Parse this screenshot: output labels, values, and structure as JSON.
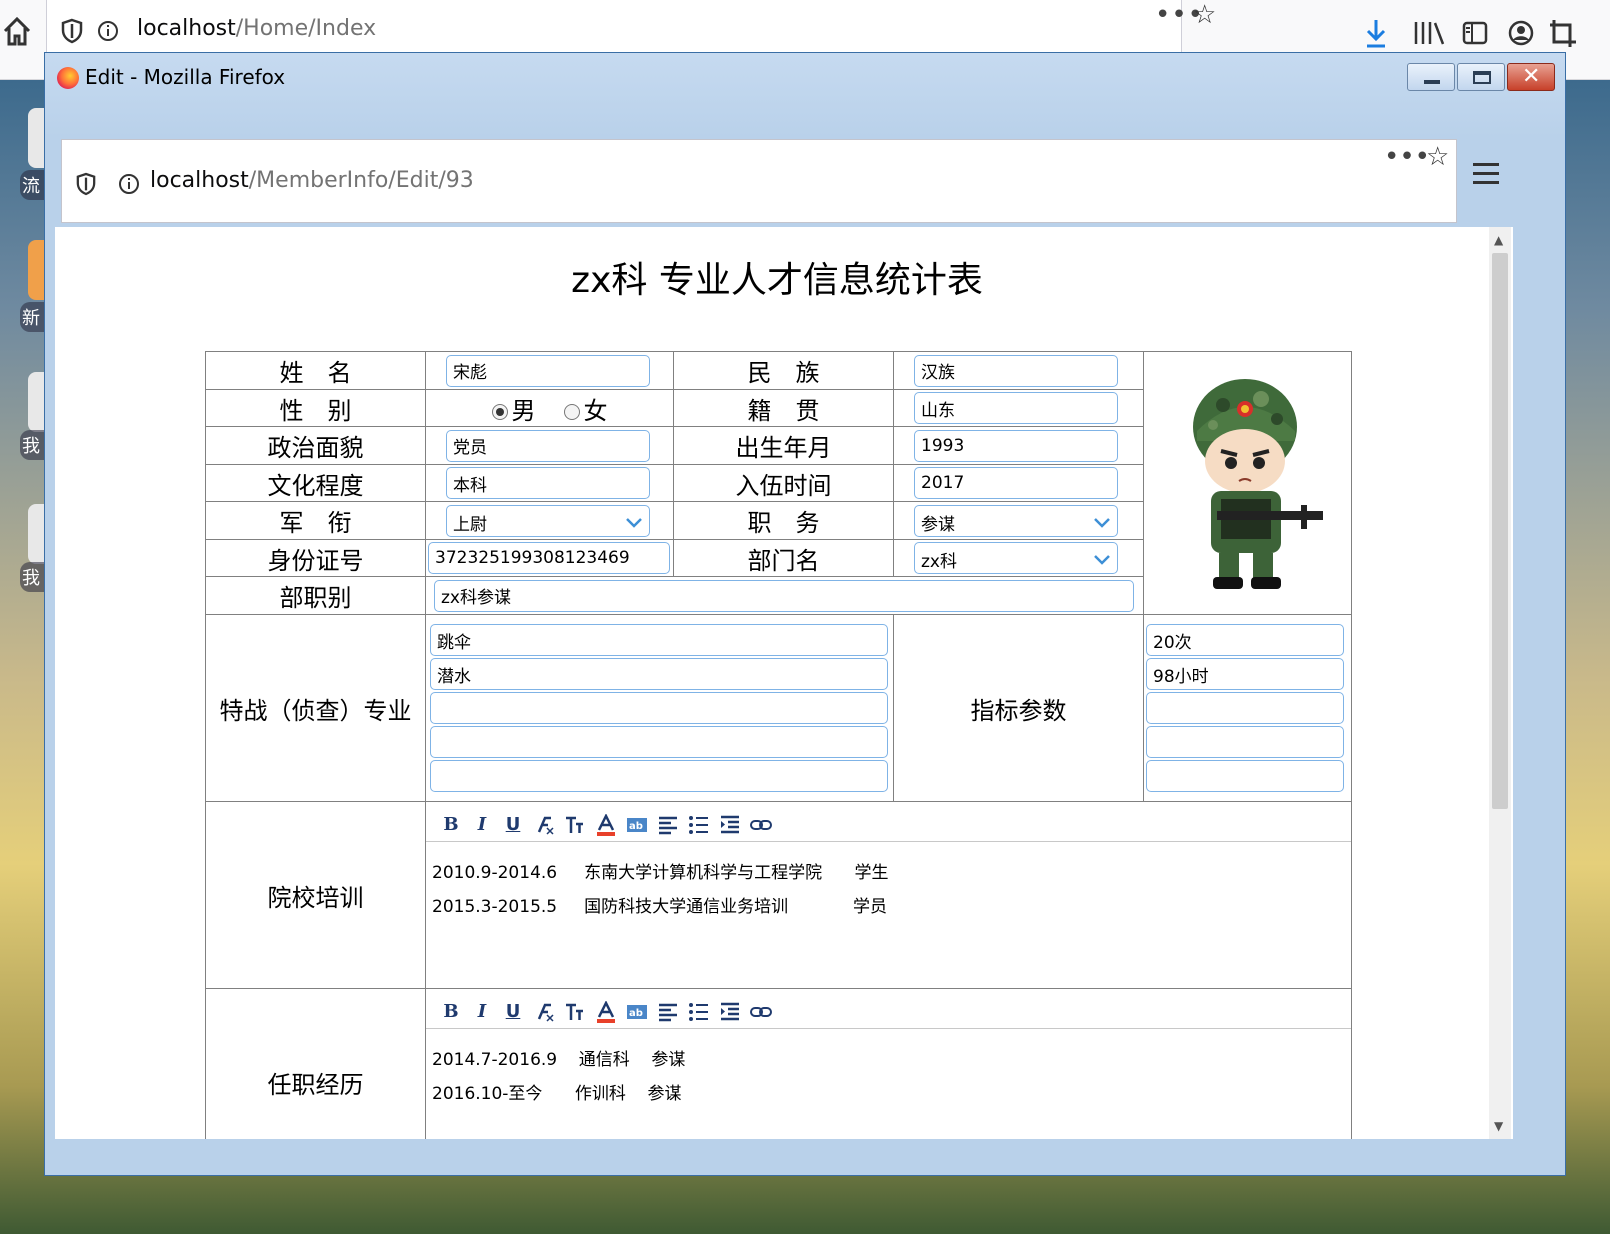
{
  "bg_browser": {
    "url_host": "localhost",
    "url_path": "/Home/Index"
  },
  "desktop": {
    "labels": [
      "流",
      "新",
      "我",
      "我"
    ]
  },
  "window": {
    "title": "Edit - Mozilla Firefox",
    "url_host": "localhost",
    "url_path": "/MemberInfo/Edit/93"
  },
  "page": {
    "title": "zx科 专业人才信息统计表"
  },
  "form": {
    "name_label": "姓　名",
    "name_value": "宋彪",
    "ethnic_label": "民　族",
    "ethnic_value": "汉族",
    "gender_label": "性　别",
    "gender_options": [
      "男",
      "女"
    ],
    "gender_selected": "男",
    "origin_label": "籍　贯",
    "origin_value": "山东",
    "political_label": "政治面貌",
    "political_value": "党员",
    "birth_label": "出生年月",
    "birth_value": "1993",
    "education_label": "文化程度",
    "education_value": "本科",
    "enlist_label": "入伍时间",
    "enlist_value": "2017",
    "rank_label": "军　衔",
    "rank_value": "上尉",
    "position_label": "职　务",
    "position_value": "参谋",
    "id_label": "身份证号",
    "id_value": "372325199308123469",
    "dept_label": "部门名",
    "dept_value": "zx科",
    "level_label": "部职别",
    "level_value": "zx科参谋",
    "specialty_label": "特战（侦查）专业",
    "specialties": [
      "跳伞",
      "潜水",
      "",
      "",
      ""
    ],
    "indicator_label": "指标参数",
    "indicators": [
      "20次",
      "98小时",
      "",
      "",
      ""
    ],
    "training_label": "院校培训",
    "training_lines": [
      "2010.9-2014.6     东南大学计算机科学与工程学院      学生",
      "2015.3-2015.5     国防科技大学通信业务培训            学员"
    ],
    "career_label": "任职经历",
    "career_lines": [
      "2014.7-2016.9    通信科    参谋",
      "2016.10-至今      作训科    参谋"
    ]
  },
  "editor_toolbar": [
    "B",
    "I",
    "U",
    "clear-format-icon",
    "font-size-icon",
    "font-color-icon",
    "highlight-icon",
    "align-icon",
    "list-icon",
    "indent-icon",
    "link-icon"
  ],
  "colors": {
    "input_border": "#7fb3e6",
    "titlebar": "#b9d1ea",
    "close_button": "#c7402a"
  }
}
